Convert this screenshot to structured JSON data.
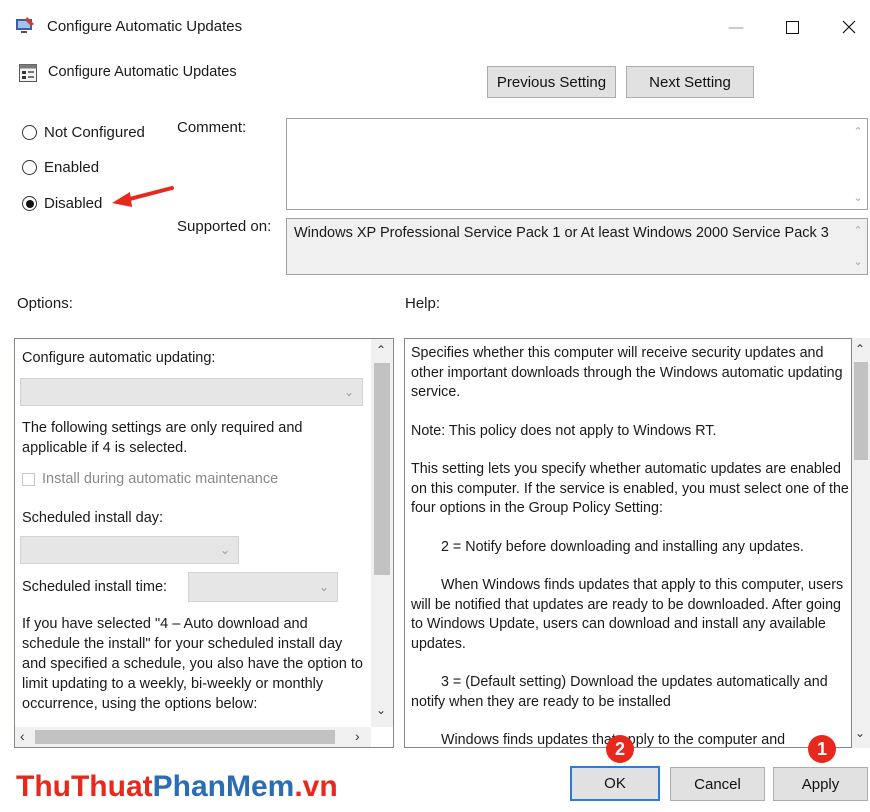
{
  "window": {
    "title": "Configure Automatic Updates",
    "controls": {
      "minimize": "—",
      "maximize": "☐",
      "close": "✕"
    }
  },
  "header": {
    "policy_title": "Configure Automatic Updates",
    "previous_label": "Previous Setting",
    "next_label": "Next Setting"
  },
  "state": {
    "options": [
      {
        "label": "Not Configured",
        "selected": false
      },
      {
        "label": "Enabled",
        "selected": false
      },
      {
        "label": "Disabled",
        "selected": true
      }
    ]
  },
  "comment": {
    "label": "Comment:",
    "value": ""
  },
  "supported": {
    "label": "Supported on:",
    "value": "Windows XP Professional Service Pack 1 or At least Windows 2000 Service Pack 3"
  },
  "options_panel": {
    "heading": "Options:",
    "configure_label": "Configure automatic updating:",
    "note": "The following settings are only required and applicable if 4 is selected.",
    "maintenance_label": "Install during automatic maintenance",
    "day_label": "Scheduled install day:",
    "time_label": "Scheduled install time:",
    "schedule_text": "If you have selected \"4 – Auto download and schedule the install\" for your scheduled install day and specified a schedule, you also have the option to limit updating to a weekly, bi-weekly or monthly occurrence, using the options below:"
  },
  "help_panel": {
    "heading": "Help:",
    "paragraphs": [
      "Specifies whether this computer will receive security updates and other important downloads through the Windows automatic updating service.",
      "Note: This policy does not apply to Windows RT.",
      "This setting lets you specify whether automatic updates are enabled on this computer. If the service is enabled, you must select one of the four options in the Group Policy Setting:",
      "2 = Notify before downloading and installing any updates.",
      "When Windows finds updates that apply to this computer, users will be notified that updates are ready to be downloaded. After going to Windows Update, users can download and install any available updates.",
      "3 = (Default setting) Download the updates automatically and notify when they are ready to be installed",
      "Windows finds updates that apply to the computer and"
    ]
  },
  "footer": {
    "ok_label": "OK",
    "cancel_label": "Cancel",
    "apply_label": "Apply"
  },
  "annotations": {
    "badge_ok": "2",
    "badge_apply": "1",
    "accent_color": "#e8271d"
  },
  "watermark": {
    "part1": "ThuThuat",
    "part2": "PhanMem",
    "part3": ".vn",
    "color1": "#e8271d",
    "color2": "#2a6db5"
  }
}
